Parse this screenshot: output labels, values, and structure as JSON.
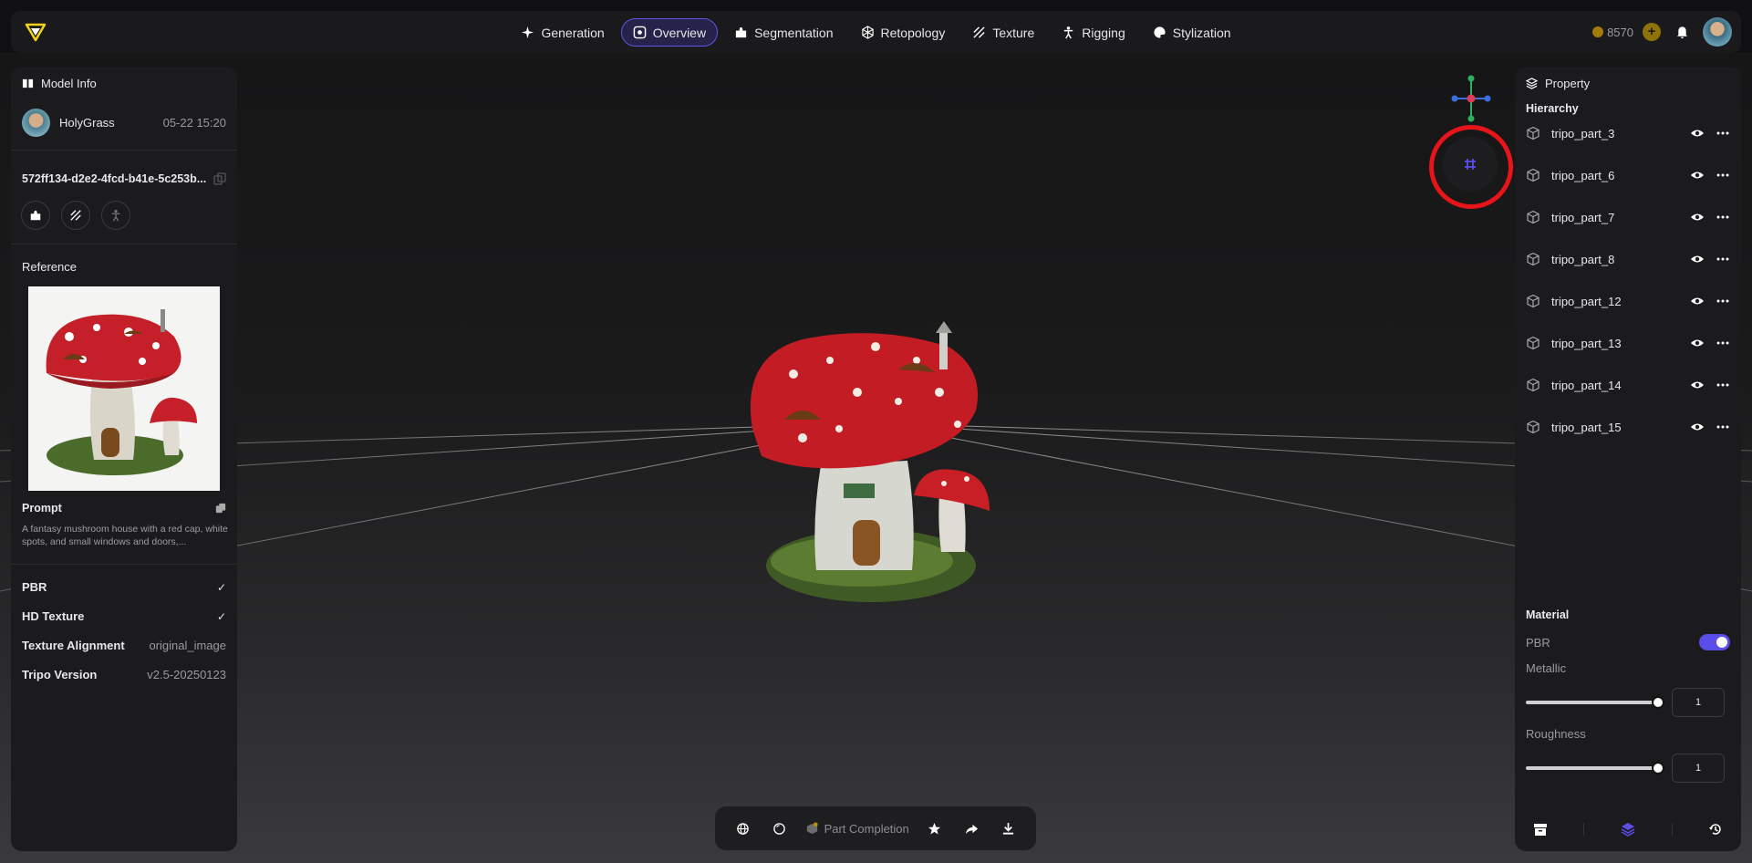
{
  "nav": {
    "tabs": [
      {
        "label": "Generation",
        "icon": "sparkle-icon"
      },
      {
        "label": "Overview",
        "icon": "overview-icon"
      },
      {
        "label": "Segmentation",
        "icon": "puzzle-icon"
      },
      {
        "label": "Retopology",
        "icon": "mesh-icon"
      },
      {
        "label": "Texture",
        "icon": "texture-icon"
      },
      {
        "label": "Rigging",
        "icon": "figure-icon"
      },
      {
        "label": "Stylization",
        "icon": "palette-icon"
      }
    ],
    "active_tab": "Overview",
    "credits": "8570"
  },
  "model_info": {
    "title": "Model Info",
    "username": "HolyGrass",
    "date": "05-22 15:20",
    "model_id": "572ff134-d2e2-4fcd-b41e-5c253b...",
    "reference_label": "Reference",
    "prompt_label": "Prompt",
    "prompt_text": "A fantasy mushroom house with a red cap, white spots, and small windows and doors,...",
    "settings": [
      {
        "label": "PBR",
        "value": "✓"
      },
      {
        "label": "HD Texture",
        "value": "✓"
      },
      {
        "label": "Texture Alignment",
        "value": "original_image"
      },
      {
        "label": "Tripo Version",
        "value": "v2.5-20250123"
      }
    ]
  },
  "property": {
    "title": "Property",
    "hierarchy_label": "Hierarchy",
    "parts": [
      "tripo_part_3",
      "tripo_part_6",
      "tripo_part_7",
      "tripo_part_8",
      "tripo_part_12",
      "tripo_part_13",
      "tripo_part_14",
      "tripo_part_15"
    ],
    "material_label": "Material",
    "pbr_label": "PBR",
    "pbr_enabled": true,
    "metallic_label": "Metallic",
    "metallic_value": "1",
    "roughness_label": "Roughness",
    "roughness_value": "1"
  },
  "toolbar": {
    "part_completion_label": "Part Completion"
  },
  "colors": {
    "accent": "#5b4de8",
    "highlight_ring": "#e7141a",
    "credit_gold": "#a27d0b"
  }
}
